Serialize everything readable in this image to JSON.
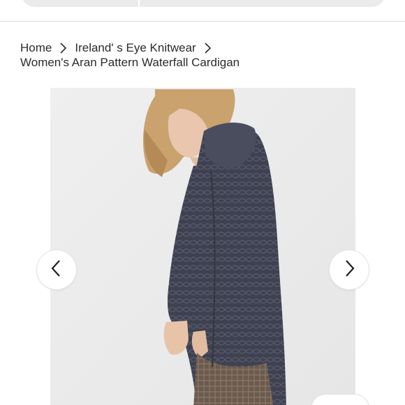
{
  "breadcrumb": {
    "home": "Home",
    "category": "Ireland' s Eye Knitwear",
    "current": "Women's Aran Pattern Waterfall Cardigan"
  },
  "gallery": {
    "image_subject": "woman wearing charcoal aran cardigan",
    "prev_icon": "chevron-left-icon",
    "next_icon": "chevron-right-icon"
  },
  "colors": {
    "text": "#2b2b2b",
    "cardigan": "#3f4150",
    "background_photo": "#ececec",
    "search_bar": "#ebebeb"
  }
}
